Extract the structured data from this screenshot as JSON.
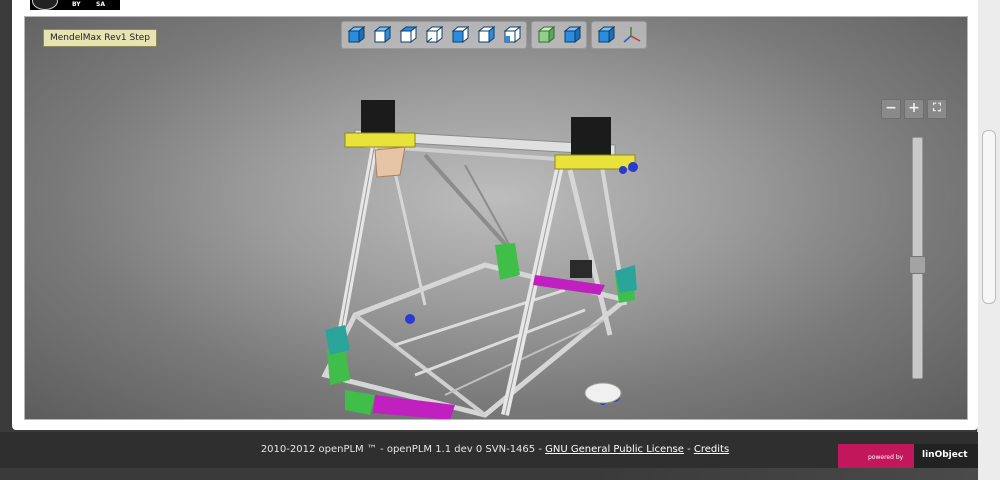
{
  "license": {
    "by": "BY",
    "sa": "SA"
  },
  "viewer": {
    "model_title": "MendelMax Rev1 Step",
    "toolbar": {
      "views": [
        "view-front",
        "view-rear",
        "view-top",
        "view-bottom",
        "view-left",
        "view-right",
        "view-iso"
      ],
      "render": [
        "render-shaded",
        "render-wire"
      ],
      "extras": [
        "view-axis-icon",
        "axis-triad-icon"
      ]
    },
    "zoom": {
      "out": "−",
      "in": "+",
      "fit": "⛶"
    },
    "slider_level": 0.47
  },
  "footer": {
    "prefix": "2010-2012 openPLM ™ - openPLM 1.1 dev 0 SVN-1465 - ",
    "license_link": "GNU General Public License",
    "separator": " - ",
    "credits_link": "Credits",
    "powered_by": "powered by",
    "brand": "linObject"
  },
  "colors": {
    "accent": "#c2185b",
    "cube": "#2b8de0",
    "model_frame": "#e8e8e8"
  }
}
